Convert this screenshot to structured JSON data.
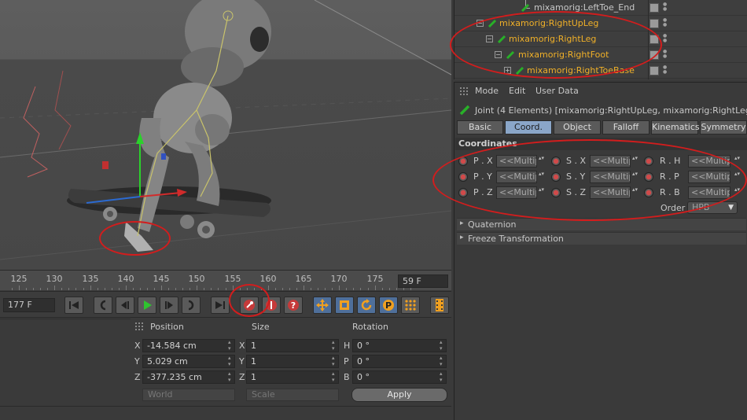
{
  "timeline": {
    "ticks": [
      "125",
      "130",
      "135",
      "140",
      "145",
      "150",
      "155",
      "160",
      "165",
      "170",
      "175"
    ],
    "end_frame": "59 F"
  },
  "transport": {
    "current_frame": "177 F"
  },
  "coords": {
    "headers": {
      "position": "Position",
      "size": "Size",
      "rotation": "Rotation"
    },
    "rows": [
      {
        "axis": "X",
        "position": "-14.584 cm",
        "size_axis": "X",
        "size": "1",
        "rot_axis": "H",
        "rotation": "0 °"
      },
      {
        "axis": "Y",
        "position": "5.029 cm",
        "size_axis": "Y",
        "size": "1",
        "rot_axis": "P",
        "rotation": "0 °"
      },
      {
        "axis": "Z",
        "position": "-377.235 cm",
        "size_axis": "Z",
        "size": "1",
        "rot_axis": "B",
        "rotation": "0 °"
      }
    ],
    "space_dropdown": "World",
    "mode_dropdown": "Scale",
    "apply_label": "Apply"
  },
  "object_manager": {
    "items": [
      {
        "label": "mixamorig:LeftToe_End",
        "selected": false
      },
      {
        "label": "mixamorig:RightUpLeg",
        "selected": true
      },
      {
        "label": "mixamorig:RightLeg",
        "selected": true
      },
      {
        "label": "mixamorig:RightFoot",
        "selected": true
      },
      {
        "label": "mixamorig:RightToeBase",
        "selected": true
      }
    ]
  },
  "attribute_manager": {
    "menu": [
      "Mode",
      "Edit",
      "User Data"
    ],
    "title": "Joint (4 Elements) [mixamorig:RightUpLeg, mixamorig:RightLeg, mixa",
    "tabs": [
      "Basic",
      "Coord.",
      "Object",
      "Falloff",
      "Kinematics",
      "Symmetry"
    ],
    "active_tab": "Coord.",
    "section": "Coordinates",
    "params": [
      {
        "p": "P . X",
        "s": "S . X",
        "r": "R . H"
      },
      {
        "p": "P . Y",
        "s": "S . Y",
        "r": "R . P"
      },
      {
        "p": "P . Z",
        "s": "S . Z",
        "r": "R . B"
      }
    ],
    "multiple_value": "<<Multip",
    "order_label": "Order",
    "order_value": "HPB",
    "groups": [
      "Quaternion",
      "Freeze Transformation"
    ]
  },
  "colors": {
    "selected_text": "#f0b028",
    "annotation": "#d21d1d",
    "active_tab": "#8aa6c8"
  }
}
